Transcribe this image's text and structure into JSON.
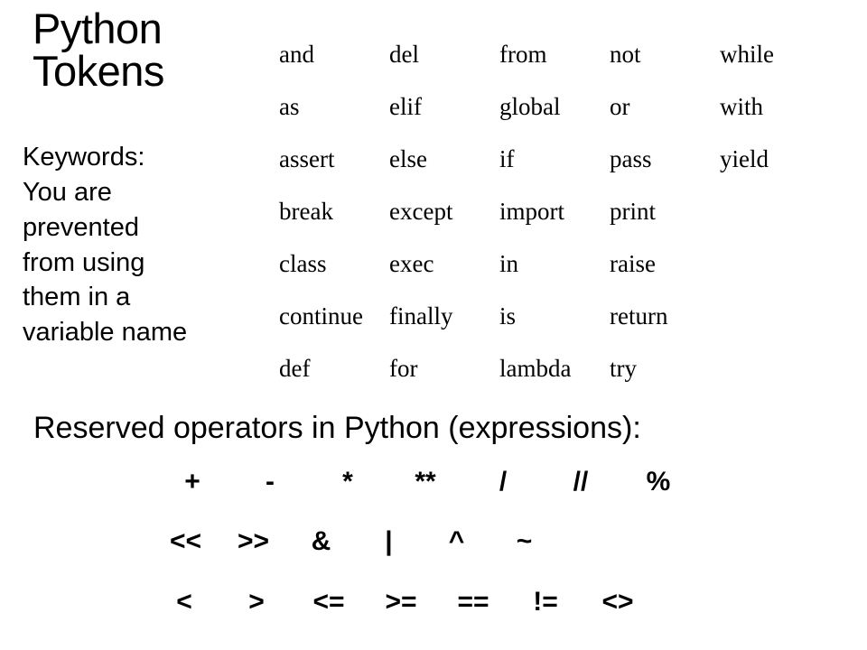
{
  "slide": {
    "title_lines": [
      "Python",
      "Tokens"
    ],
    "lead_lines": [
      "Keywords:",
      "You are",
      "prevented",
      "from using",
      "them in a",
      "variable name"
    ],
    "keywords": {
      "rows": [
        [
          "and",
          "del",
          "from",
          "not",
          "while"
        ],
        [
          "as",
          "elif",
          "global",
          "or",
          "with"
        ],
        [
          "assert",
          "else",
          "if",
          "pass",
          "yield"
        ],
        [
          "break",
          "except",
          "import",
          "print",
          ""
        ],
        [
          "class",
          "exec",
          "in",
          "raise",
          ""
        ],
        [
          "continue",
          "finally",
          "is",
          "return",
          ""
        ],
        [
          "def",
          "for",
          "lambda",
          "try",
          ""
        ]
      ]
    },
    "operators_heading": "Reserved operators in Python (expressions):",
    "operator_rows": [
      [
        "+",
        "-",
        "*",
        "**",
        "/",
        "//",
        "%"
      ],
      [
        "<<",
        ">>",
        "&",
        "|",
        "^",
        "~"
      ],
      [
        "<",
        ">",
        "<=",
        ">=",
        "==",
        "!=",
        "<>"
      ]
    ]
  },
  "colors": {
    "background": "#ffffff",
    "text": "#000000"
  }
}
